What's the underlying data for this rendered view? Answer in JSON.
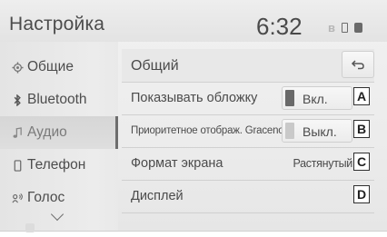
{
  "header": {
    "title": "Настройка",
    "clock": "6:32"
  },
  "status_icons": [
    "bluetooth-icon",
    "phone-icon",
    "signal-icon"
  ],
  "sidebar": {
    "items": [
      {
        "label": "Общие",
        "icon": "gear-icon"
      },
      {
        "label": "Bluetooth",
        "icon": "bluetooth-icon"
      },
      {
        "label": "Аудио",
        "icon": "music-note-icon",
        "selected": true
      },
      {
        "label": "Телефон",
        "icon": "phone-icon"
      },
      {
        "label": "Голос",
        "icon": "voice-icon"
      }
    ]
  },
  "main": {
    "title": "Общий",
    "rows": [
      {
        "label": "Показывать обложку",
        "value": "Вкл.",
        "state": "on",
        "callout": "A"
      },
      {
        "label": "Приоритетное отображ. Gracenote",
        "value": "Выкл.",
        "state": "off",
        "callout": "B"
      },
      {
        "label": "Формат экрана",
        "value": "Растянутый",
        "callout": "C"
      },
      {
        "label": "Дисплей",
        "value": "",
        "callout": "D"
      }
    ]
  },
  "colors": {
    "background": "#ececec",
    "text": "#4a4a4a",
    "indicator_on": "#6a6a6a",
    "indicator_off": "#c9c9c9"
  }
}
